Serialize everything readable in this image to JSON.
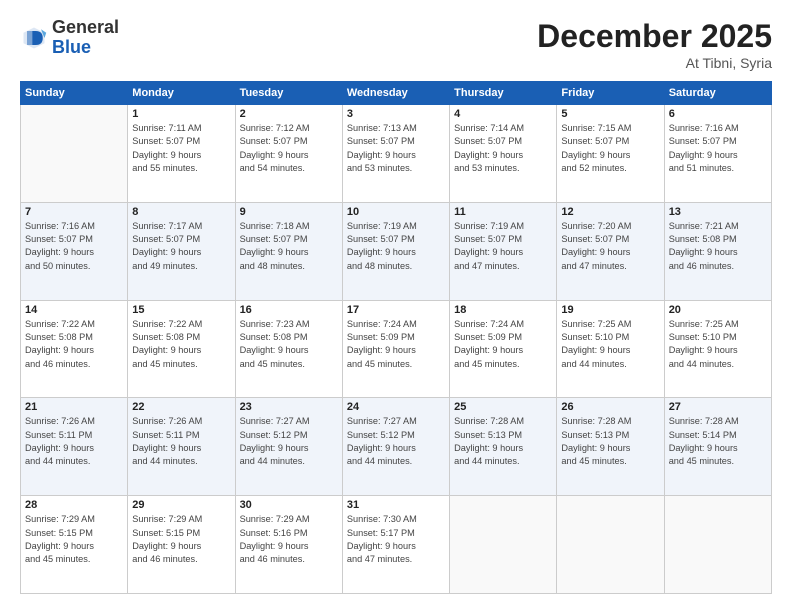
{
  "header": {
    "logo_general": "General",
    "logo_blue": "Blue",
    "month_title": "December 2025",
    "location": "At Tibni, Syria"
  },
  "days_of_week": [
    "Sunday",
    "Monday",
    "Tuesday",
    "Wednesday",
    "Thursday",
    "Friday",
    "Saturday"
  ],
  "weeks": [
    [
      {
        "day": "",
        "info": ""
      },
      {
        "day": "1",
        "info": "Sunrise: 7:11 AM\nSunset: 5:07 PM\nDaylight: 9 hours\nand 55 minutes."
      },
      {
        "day": "2",
        "info": "Sunrise: 7:12 AM\nSunset: 5:07 PM\nDaylight: 9 hours\nand 54 minutes."
      },
      {
        "day": "3",
        "info": "Sunrise: 7:13 AM\nSunset: 5:07 PM\nDaylight: 9 hours\nand 53 minutes."
      },
      {
        "day": "4",
        "info": "Sunrise: 7:14 AM\nSunset: 5:07 PM\nDaylight: 9 hours\nand 53 minutes."
      },
      {
        "day": "5",
        "info": "Sunrise: 7:15 AM\nSunset: 5:07 PM\nDaylight: 9 hours\nand 52 minutes."
      },
      {
        "day": "6",
        "info": "Sunrise: 7:16 AM\nSunset: 5:07 PM\nDaylight: 9 hours\nand 51 minutes."
      }
    ],
    [
      {
        "day": "7",
        "info": "Sunrise: 7:16 AM\nSunset: 5:07 PM\nDaylight: 9 hours\nand 50 minutes."
      },
      {
        "day": "8",
        "info": "Sunrise: 7:17 AM\nSunset: 5:07 PM\nDaylight: 9 hours\nand 49 minutes."
      },
      {
        "day": "9",
        "info": "Sunrise: 7:18 AM\nSunset: 5:07 PM\nDaylight: 9 hours\nand 48 minutes."
      },
      {
        "day": "10",
        "info": "Sunrise: 7:19 AM\nSunset: 5:07 PM\nDaylight: 9 hours\nand 48 minutes."
      },
      {
        "day": "11",
        "info": "Sunrise: 7:19 AM\nSunset: 5:07 PM\nDaylight: 9 hours\nand 47 minutes."
      },
      {
        "day": "12",
        "info": "Sunrise: 7:20 AM\nSunset: 5:07 PM\nDaylight: 9 hours\nand 47 minutes."
      },
      {
        "day": "13",
        "info": "Sunrise: 7:21 AM\nSunset: 5:08 PM\nDaylight: 9 hours\nand 46 minutes."
      }
    ],
    [
      {
        "day": "14",
        "info": "Sunrise: 7:22 AM\nSunset: 5:08 PM\nDaylight: 9 hours\nand 46 minutes."
      },
      {
        "day": "15",
        "info": "Sunrise: 7:22 AM\nSunset: 5:08 PM\nDaylight: 9 hours\nand 45 minutes."
      },
      {
        "day": "16",
        "info": "Sunrise: 7:23 AM\nSunset: 5:08 PM\nDaylight: 9 hours\nand 45 minutes."
      },
      {
        "day": "17",
        "info": "Sunrise: 7:24 AM\nSunset: 5:09 PM\nDaylight: 9 hours\nand 45 minutes."
      },
      {
        "day": "18",
        "info": "Sunrise: 7:24 AM\nSunset: 5:09 PM\nDaylight: 9 hours\nand 45 minutes."
      },
      {
        "day": "19",
        "info": "Sunrise: 7:25 AM\nSunset: 5:10 PM\nDaylight: 9 hours\nand 44 minutes."
      },
      {
        "day": "20",
        "info": "Sunrise: 7:25 AM\nSunset: 5:10 PM\nDaylight: 9 hours\nand 44 minutes."
      }
    ],
    [
      {
        "day": "21",
        "info": "Sunrise: 7:26 AM\nSunset: 5:11 PM\nDaylight: 9 hours\nand 44 minutes."
      },
      {
        "day": "22",
        "info": "Sunrise: 7:26 AM\nSunset: 5:11 PM\nDaylight: 9 hours\nand 44 minutes."
      },
      {
        "day": "23",
        "info": "Sunrise: 7:27 AM\nSunset: 5:12 PM\nDaylight: 9 hours\nand 44 minutes."
      },
      {
        "day": "24",
        "info": "Sunrise: 7:27 AM\nSunset: 5:12 PM\nDaylight: 9 hours\nand 44 minutes."
      },
      {
        "day": "25",
        "info": "Sunrise: 7:28 AM\nSunset: 5:13 PM\nDaylight: 9 hours\nand 44 minutes."
      },
      {
        "day": "26",
        "info": "Sunrise: 7:28 AM\nSunset: 5:13 PM\nDaylight: 9 hours\nand 45 minutes."
      },
      {
        "day": "27",
        "info": "Sunrise: 7:28 AM\nSunset: 5:14 PM\nDaylight: 9 hours\nand 45 minutes."
      }
    ],
    [
      {
        "day": "28",
        "info": "Sunrise: 7:29 AM\nSunset: 5:15 PM\nDaylight: 9 hours\nand 45 minutes."
      },
      {
        "day": "29",
        "info": "Sunrise: 7:29 AM\nSunset: 5:15 PM\nDaylight: 9 hours\nand 46 minutes."
      },
      {
        "day": "30",
        "info": "Sunrise: 7:29 AM\nSunset: 5:16 PM\nDaylight: 9 hours\nand 46 minutes."
      },
      {
        "day": "31",
        "info": "Sunrise: 7:30 AM\nSunset: 5:17 PM\nDaylight: 9 hours\nand 47 minutes."
      },
      {
        "day": "",
        "info": ""
      },
      {
        "day": "",
        "info": ""
      },
      {
        "day": "",
        "info": ""
      }
    ]
  ]
}
